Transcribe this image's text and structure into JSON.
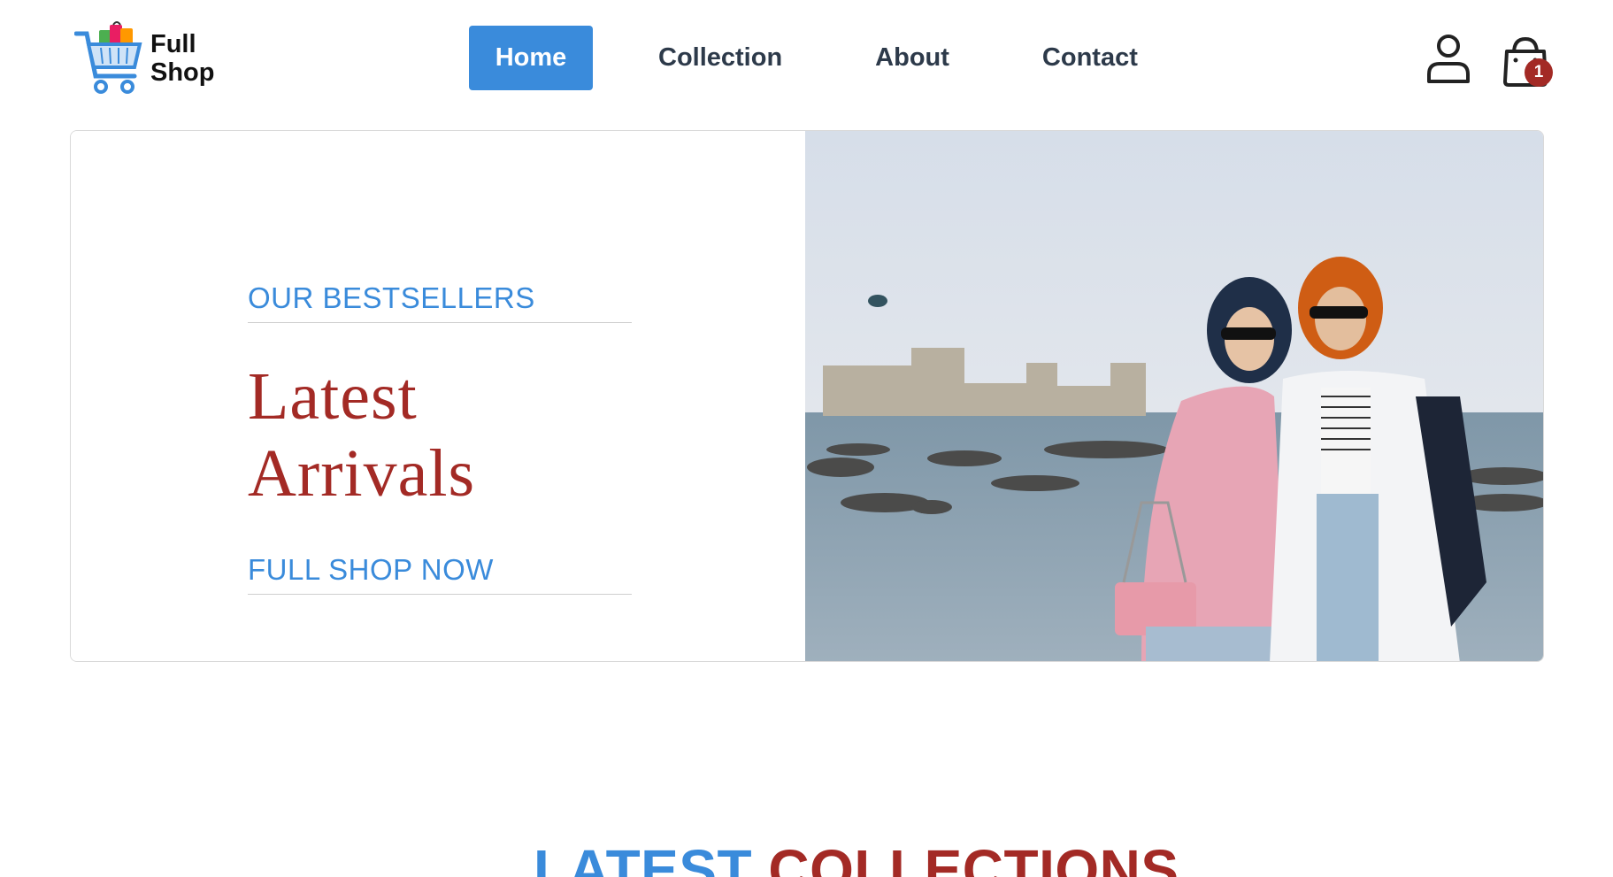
{
  "brand": {
    "name_line1": "Full",
    "name_line2": "Shop",
    "logo_icon": "shopping-cart-with-bags-icon"
  },
  "nav": {
    "items": [
      {
        "label": "Home",
        "active": true
      },
      {
        "label": "Collection",
        "active": false
      },
      {
        "label": "About",
        "active": false
      },
      {
        "label": "Contact",
        "active": false
      }
    ]
  },
  "header_actions": {
    "user_icon": "user-icon",
    "cart_icon": "shopping-bag-icon",
    "cart_count": "1"
  },
  "hero": {
    "eyebrow": "OUR BESTSELLERS",
    "title": "Latest Arrivals",
    "cta": "FULL SHOP NOW",
    "image_alt": "two women in headscarves and sunglasses standing by the sea with a stone castle in the background"
  },
  "section": {
    "title_part1": "LATEST",
    "title_part2": "COLLECTIONS"
  },
  "colors": {
    "primary_blue": "#3a8bdb",
    "accent_red": "#a32a25",
    "text_dark": "#2d3a4a"
  }
}
